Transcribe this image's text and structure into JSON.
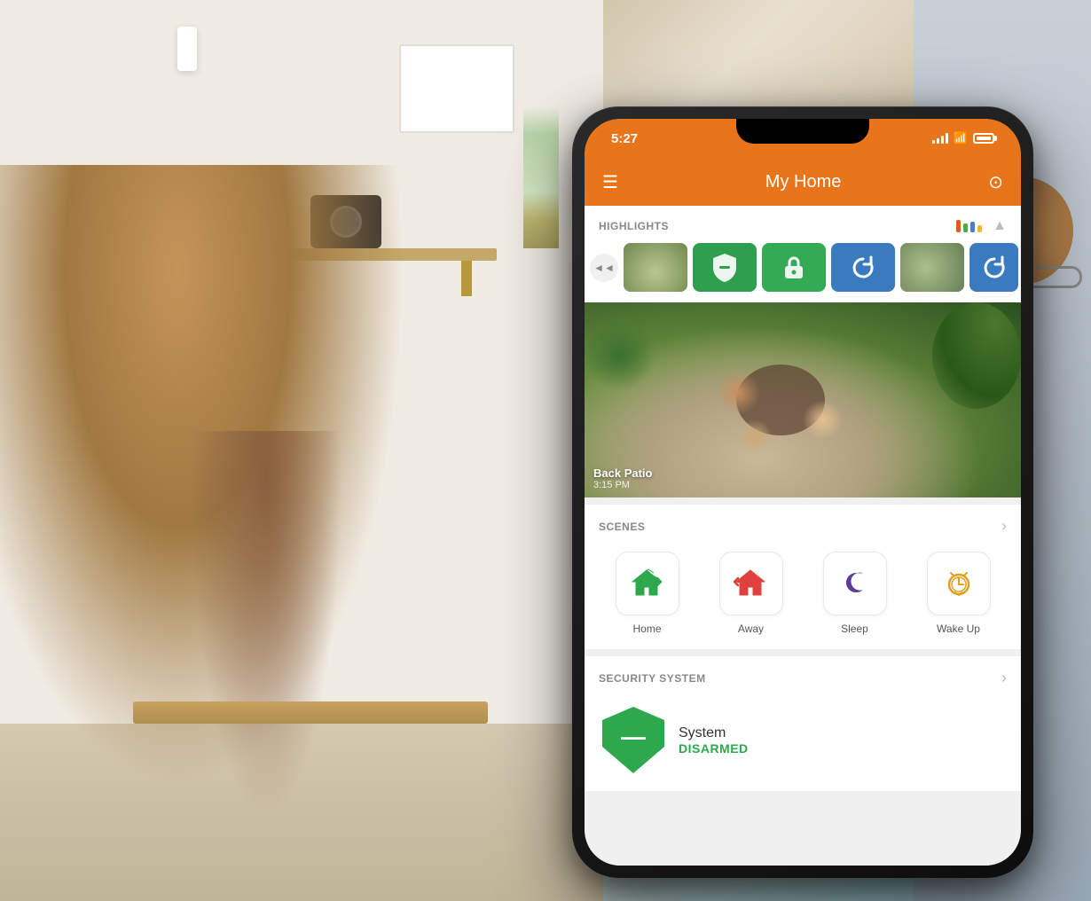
{
  "app": {
    "title": "My Home",
    "status_bar": {
      "time": "5:27",
      "signal": 4,
      "wifi": true,
      "battery": 80
    },
    "header": {
      "menu_label": "☰",
      "title": "My Home",
      "settings_label": "⊙"
    },
    "highlights": {
      "section_title": "HIGHLIGHTS",
      "collapse_icon": "▲",
      "color_bars": [
        "#e05c1a",
        "#4caa4c",
        "#4c7cc8",
        "#f0b830"
      ]
    },
    "camera": {
      "location": "Back Patio",
      "time": "3:15 PM"
    },
    "scenes": {
      "section_title": "SCENES",
      "arrow": "›",
      "items": [
        {
          "id": "home",
          "label": "Home",
          "icon": "🏠",
          "icon_color": "#2ea84c"
        },
        {
          "id": "away",
          "label": "Away",
          "icon": "🏠",
          "icon_color": "#e04040"
        },
        {
          "id": "sleep",
          "label": "Sleep",
          "icon": "🌙",
          "icon_color": "#5a3e9a"
        },
        {
          "id": "wakeup",
          "label": "Wake Up",
          "icon": "⏰",
          "icon_color": "#e0a020"
        }
      ]
    },
    "security": {
      "section_title": "SECURITY SYSTEM",
      "arrow": "›",
      "system_label": "System",
      "status": "DISARMED",
      "status_color": "#2ea84c"
    }
  }
}
